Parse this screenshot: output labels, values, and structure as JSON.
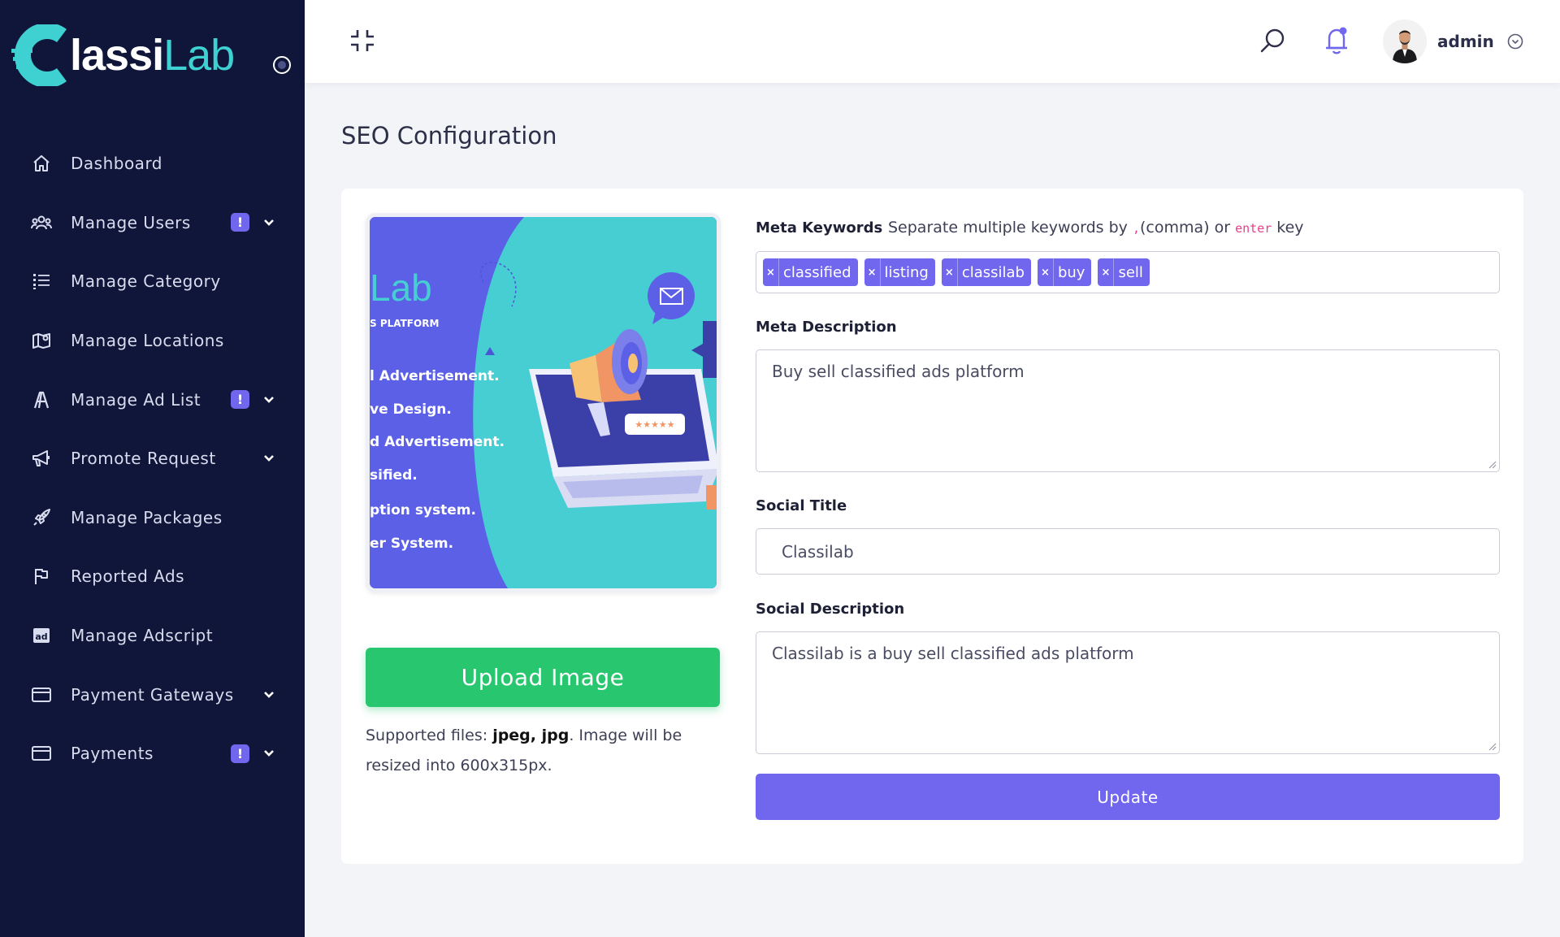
{
  "brand": {
    "name_part1": "lassi",
    "name_part2": "Lab",
    "accent": "#3fd0d2"
  },
  "sidebar": {
    "items": [
      {
        "label": "Dashboard",
        "icon": "home-icon",
        "badge": "",
        "has_chevron": false
      },
      {
        "label": "Manage Users",
        "icon": "users-icon",
        "badge": "!",
        "has_chevron": true
      },
      {
        "label": "Manage Category",
        "icon": "list-icon",
        "badge": "",
        "has_chevron": false
      },
      {
        "label": "Manage Locations",
        "icon": "map-icon",
        "badge": "",
        "has_chevron": false
      },
      {
        "label": "Manage Ad List",
        "icon": "ad-list-icon",
        "badge": "!",
        "has_chevron": true
      },
      {
        "label": "Promote Request",
        "icon": "megaphone-icon",
        "badge": "",
        "has_chevron": true
      },
      {
        "label": "Manage Packages",
        "icon": "rocket-icon",
        "badge": "",
        "has_chevron": false
      },
      {
        "label": "Reported Ads",
        "icon": "flag-icon",
        "badge": "",
        "has_chevron": false
      },
      {
        "label": "Manage Adscript",
        "icon": "ad-icon",
        "badge": "",
        "has_chevron": false
      },
      {
        "label": "Payment Gateways",
        "icon": "card-icon",
        "badge": "",
        "has_chevron": true
      },
      {
        "label": "Payments",
        "icon": "card-icon",
        "badge": "!",
        "has_chevron": true
      }
    ]
  },
  "topbar": {
    "user_name": "admin"
  },
  "page": {
    "title": "SEO Configuration"
  },
  "preview": {
    "logo_fragment": "Lab",
    "tagline_fragment": "S PLATFORM",
    "features": [
      "l Advertisement.",
      "ve Design.",
      "d Advertisement.",
      "sified.",
      "ption system.",
      "er System."
    ]
  },
  "upload": {
    "button_label": "Upload Image",
    "note_prefix": "Supported files: ",
    "note_types": "jpeg, jpg",
    "note_suffix": ". Image will be resized into 600x315px."
  },
  "form": {
    "meta_keywords_label": "Meta Keywords",
    "meta_keywords_hint_1": "Separate multiple keywords by ",
    "meta_keywords_hint_code1": ",",
    "meta_keywords_hint_2": "(comma) or ",
    "meta_keywords_hint_code2": "enter",
    "meta_keywords_hint_3": " key",
    "keywords": [
      "classified",
      "listing",
      "classilab",
      "buy",
      "sell"
    ],
    "meta_description_label": "Meta Description",
    "meta_description_value": "Buy sell classified ads platform",
    "social_title_label": "Social Title",
    "social_title_value": "Classilab",
    "social_description_label": "Social Description",
    "social_description_value": "Classilab is a buy sell classified ads platform",
    "update_label": "Update"
  },
  "colors": {
    "sidebar_bg": "#10163a",
    "primary": "#7166ee",
    "success": "#28c76f"
  }
}
